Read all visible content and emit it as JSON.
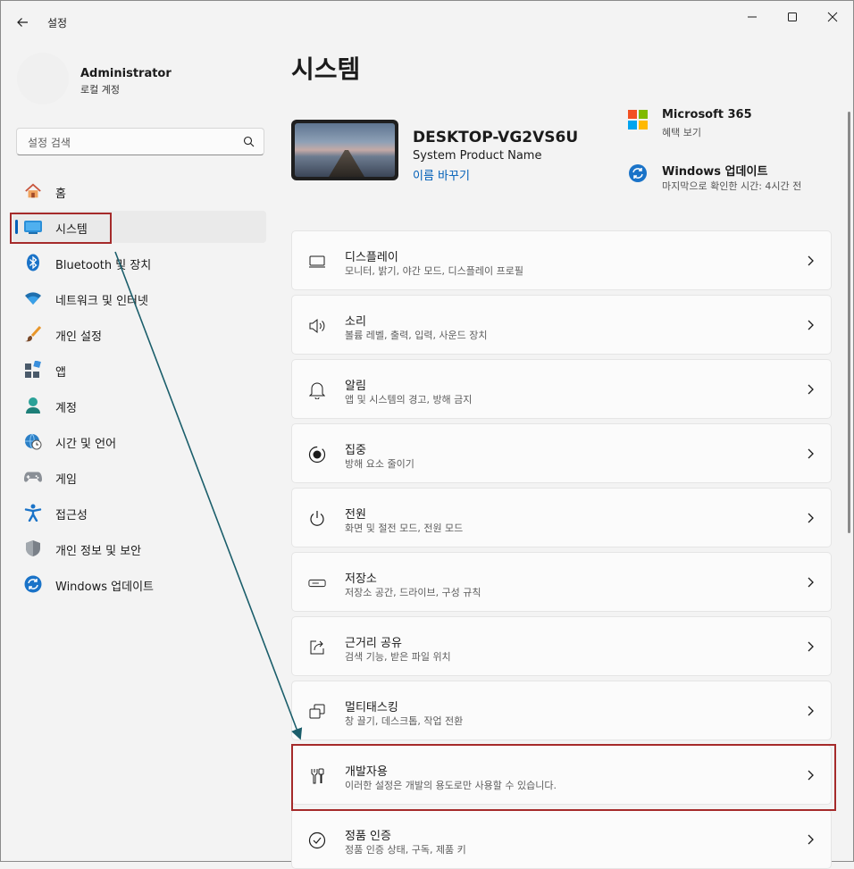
{
  "window": {
    "title": "설정",
    "controls": [
      "minimize-icon",
      "maximize-icon",
      "close-icon"
    ]
  },
  "profile": {
    "name": "Administrator",
    "account_type": "로컬 계정"
  },
  "search": {
    "placeholder": "설정 검색"
  },
  "sidebar": {
    "items": [
      {
        "label": "홈",
        "icon": "home-icon"
      },
      {
        "label": "시스템",
        "icon": "monitor-icon",
        "selected": true
      },
      {
        "label": "Bluetooth 및 장치",
        "icon": "bluetooth-icon"
      },
      {
        "label": "네트워크 및 인터넷",
        "icon": "wifi-icon"
      },
      {
        "label": "개인 설정",
        "icon": "brush-icon"
      },
      {
        "label": "앱",
        "icon": "apps-icon"
      },
      {
        "label": "계정",
        "icon": "person-icon"
      },
      {
        "label": "시간 및 언어",
        "icon": "clock-globe-icon"
      },
      {
        "label": "게임",
        "icon": "gamepad-icon"
      },
      {
        "label": "접근성",
        "icon": "accessibility-icon"
      },
      {
        "label": "개인 정보 및 보안",
        "icon": "shield-icon"
      },
      {
        "label": "Windows 업데이트",
        "icon": "update-icon"
      }
    ]
  },
  "main": {
    "title": "시스템",
    "device": {
      "name": "DESKTOP-VG2VS6U",
      "model": "System Product Name",
      "rename_link": "이름 바꾸기"
    },
    "tiles": [
      {
        "title": "Microsoft 365",
        "subtitle": "혜택 보기",
        "icon": "microsoft-logo-icon"
      },
      {
        "title": "Windows 업데이트",
        "subtitle": "마지막으로 확인한 시간: 4시간 전",
        "icon": "update-icon"
      }
    ],
    "settings": [
      {
        "title": "디스플레이",
        "subtitle": "모니터, 밝기, 야간 모드, 디스플레이 프로필",
        "icon": "display-icon"
      },
      {
        "title": "소리",
        "subtitle": "볼륨 레벨, 출력, 입력, 사운드 장치",
        "icon": "speaker-icon"
      },
      {
        "title": "알림",
        "subtitle": "앱 및 시스템의 경고, 방해 금지",
        "icon": "bell-icon"
      },
      {
        "title": "집중",
        "subtitle": "방해 요소 줄이기",
        "icon": "focus-icon"
      },
      {
        "title": "전원",
        "subtitle": "화면 및 절전 모드, 전원 모드",
        "icon": "power-icon"
      },
      {
        "title": "저장소",
        "subtitle": "저장소 공간, 드라이브, 구성 규칙",
        "icon": "storage-icon"
      },
      {
        "title": "근거리 공유",
        "subtitle": "검색 기능, 받은 파일 위치",
        "icon": "share-icon"
      },
      {
        "title": "멀티태스킹",
        "subtitle": "창 끌기, 데스크톱, 작업 전환",
        "icon": "multitask-icon"
      },
      {
        "title": "개발자용",
        "subtitle": "이러한 설정은 개발의 용도로만 사용할 수 있습니다.",
        "icon": "developer-tools-icon",
        "highlighted": true
      },
      {
        "title": "정품 인증",
        "subtitle": "정품 인증 상태, 구독, 제품 키",
        "icon": "activation-check-icon"
      }
    ]
  },
  "colors": {
    "accent": "#005fb8",
    "annotation": "#a52a2a",
    "arrow": "#1b5e6b",
    "background": "#f3f3f3",
    "card": "#fbfbfb"
  }
}
